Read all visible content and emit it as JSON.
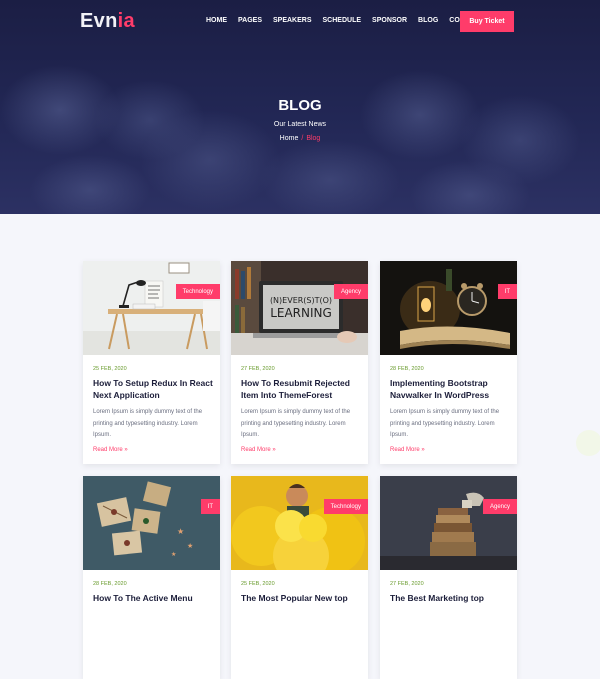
{
  "header": {
    "logo_main": "Evn",
    "logo_accent": "ia",
    "nav": [
      "HOME",
      "PAGES",
      "SPEAKERS",
      "SCHEDULE",
      "SPONSOR",
      "BLOG",
      "CONTACT"
    ],
    "cta_label": "Buy Ticket"
  },
  "hero": {
    "title": "BLOG",
    "subtitle": "Our Latest News",
    "breadcrumb_home": "Home",
    "breadcrumb_sep": "/",
    "breadcrumb_current": "Blog"
  },
  "colors": {
    "accent": "#ff3c6a",
    "hero_bg": "#1f2350",
    "date": "#6a9c2f"
  },
  "posts": [
    {
      "tag": "Technology",
      "date": "25 FEB, 2020",
      "title": "How To Setup Redux In React Next Application",
      "excerpt": "Lorem Ipsum is simply dummy text of the printing and typesetting industry. Lorem Ipsum.",
      "more": "Read More »"
    },
    {
      "tag": "Agency",
      "date": "27 FEB, 2020",
      "title": "How To Resubmit Rejected Item Into ThemeForest",
      "excerpt": "Lorem Ipsum is simply dummy text of the printing and typesetting industry. Lorem Ipsum.",
      "more": "Read More »"
    },
    {
      "tag": "IT",
      "date": "28 FEB, 2020",
      "title": "Implementing Bootstrap Navwalker In WordPress",
      "excerpt": "Lorem Ipsum is simply dummy text of the printing and typesetting industry. Lorem Ipsum.",
      "more": "Read More »"
    },
    {
      "tag": "IT",
      "date": "28 FEB, 2020",
      "title": "How To The Active Menu",
      "excerpt": "",
      "more": ""
    },
    {
      "tag": "Technology",
      "date": "25 FEB, 2020",
      "title": "The Most Popular New top",
      "excerpt": "",
      "more": ""
    },
    {
      "tag": "Agency",
      "date": "27 FEB, 2020",
      "title": "The Best Marketing top",
      "excerpt": "",
      "more": ""
    }
  ]
}
